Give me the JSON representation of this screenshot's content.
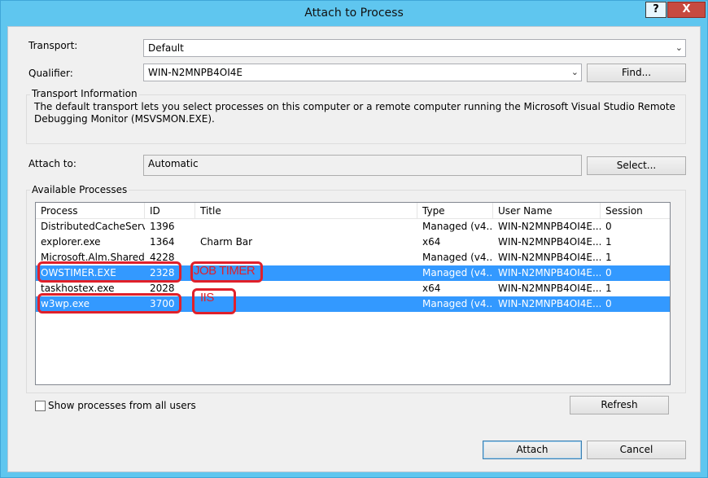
{
  "window": {
    "title": "Attach to Process",
    "help": "?",
    "close": "X"
  },
  "transport": {
    "label": "Transport:",
    "value": "Default"
  },
  "qualifier": {
    "label": "Qualifier:",
    "value": "WIN-N2MNPB4OI4E",
    "find_button": "Find..."
  },
  "transport_info": {
    "title": "Transport Information",
    "text": "The default transport lets you select processes on this computer or a remote computer running the Microsoft Visual Studio Remote Debugging Monitor (MSVSMON.EXE)."
  },
  "attach_to": {
    "label": "Attach to:",
    "value": "Automatic",
    "select_button": "Select..."
  },
  "processes": {
    "title": "Available Processes",
    "columns": [
      "Process",
      "ID",
      "Title",
      "Type",
      "User Name",
      "Session"
    ],
    "rows": [
      {
        "process": "DistributedCacheServ...",
        "id": "1396",
        "title": "",
        "type": "Managed (v4....",
        "user": "WIN-N2MNPB4OI4E...",
        "session": "0",
        "selected": false
      },
      {
        "process": "explorer.exe",
        "id": "1364",
        "title": "Charm Bar",
        "type": "x64",
        "user": "WIN-N2MNPB4OI4E...",
        "session": "1",
        "selected": false
      },
      {
        "process": "Microsoft.Alm.Shared...",
        "id": "4228",
        "title": "",
        "type": "Managed (v4....",
        "user": "WIN-N2MNPB4OI4E...",
        "session": "1",
        "selected": false
      },
      {
        "process": "OWSTIMER.EXE",
        "id": "2328",
        "title": "",
        "type": "Managed (v4....",
        "user": "WIN-N2MNPB4OI4E...",
        "session": "0",
        "selected": true
      },
      {
        "process": "taskhostex.exe",
        "id": "2028",
        "title": "",
        "type": "x64",
        "user": "WIN-N2MNPB4OI4E...",
        "session": "1",
        "selected": false
      },
      {
        "process": "w3wp.exe",
        "id": "3700",
        "title": "",
        "type": "Managed (v4....",
        "user": "WIN-N2MNPB4OI4E...",
        "session": "0",
        "selected": true
      }
    ],
    "show_all_label": "Show processes from all users",
    "refresh_button": "Refresh"
  },
  "annotations": {
    "job_timer": "JOB TIMER",
    "iis": "IIS"
  },
  "footer": {
    "attach_button": "Attach",
    "cancel_button": "Cancel"
  },
  "colors": {
    "selection": "#3399ff",
    "annotation": "#e0202a",
    "titlebar": "#5fc6ef"
  }
}
